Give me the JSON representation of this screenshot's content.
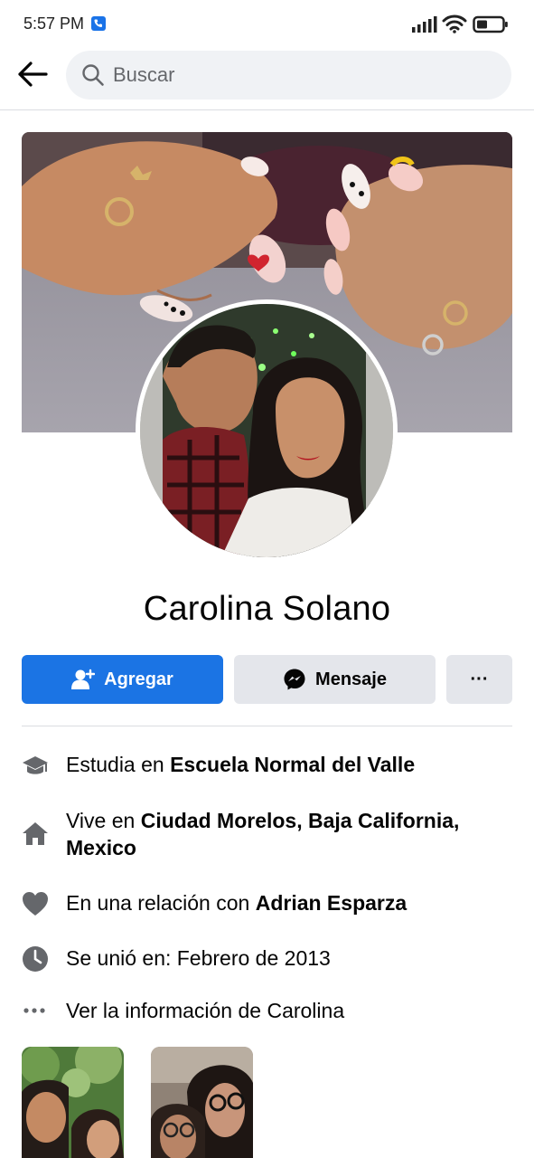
{
  "status_bar": {
    "time": "5:57 PM",
    "icons": [
      "phone-call-badge-icon",
      "cell-signal-icon",
      "wifi-icon",
      "battery-icon"
    ]
  },
  "search": {
    "placeholder": "Buscar"
  },
  "profile": {
    "name": "Carolina Solano"
  },
  "actions": {
    "add_label": "Agregar",
    "message_label": "Mensaje",
    "more_label": "···"
  },
  "intro": {
    "study": {
      "prefix": "Estudia en ",
      "value": "Escuela Normal del Valle",
      "icon": "graduation-cap-icon"
    },
    "lives": {
      "prefix": "Vive en ",
      "value": "Ciudad Morelos, Baja California, Mexico",
      "icon": "house-icon"
    },
    "relationship": {
      "prefix": "En una relación con ",
      "value": "Adrian Esparza",
      "icon": "heart-icon"
    },
    "joined": {
      "text": "Se unió en: Febrero de 2013",
      "icon": "clock-icon"
    },
    "more_info": {
      "text": "Ver la información de Carolina",
      "icon": "more-dots-icon"
    }
  },
  "colors": {
    "primary_blue": "#1b74e4",
    "secondary_button": "#e4e6eb",
    "search_bg": "#f0f2f5",
    "icon_gray": "#65676b",
    "text": "#050505",
    "divider": "#dadde1"
  }
}
